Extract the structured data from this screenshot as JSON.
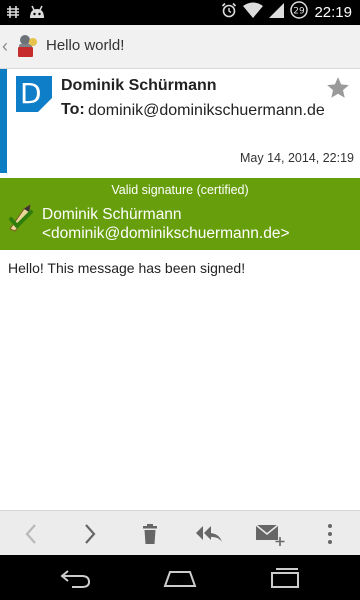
{
  "status_bar": {
    "time": "22:19",
    "battery_level": "29",
    "icons": [
      "notification-icon",
      "android-icon",
      "alarm-icon",
      "wifi-icon",
      "signal-icon",
      "battery-icon"
    ]
  },
  "action_bar": {
    "title": "Hello world!",
    "icons": [
      "up-caret-icon",
      "app-icon"
    ]
  },
  "header": {
    "avatar_letter": "D",
    "sender_name": "Dominik Schürmann",
    "to_label": "To:",
    "to_address": "dominik@dominikschuermann.de",
    "date": "May 14, 2014, 22:19",
    "accent_color": "#0c7dc2"
  },
  "signature": {
    "status": "Valid signature (certified)",
    "user_name": "Dominik Schürmann",
    "user_email": "<dominik@dominikschuermann.de>",
    "background_color": "#679e0c"
  },
  "message": {
    "body": "Hello! This message has been signed!"
  },
  "toolbar": {
    "icons": [
      "previous-icon",
      "next-icon",
      "delete-icon",
      "reply-all-icon",
      "compose-icon",
      "overflow-menu-icon"
    ]
  },
  "nav_bar": {
    "icons": [
      "back-icon",
      "home-icon",
      "recents-icon"
    ]
  }
}
